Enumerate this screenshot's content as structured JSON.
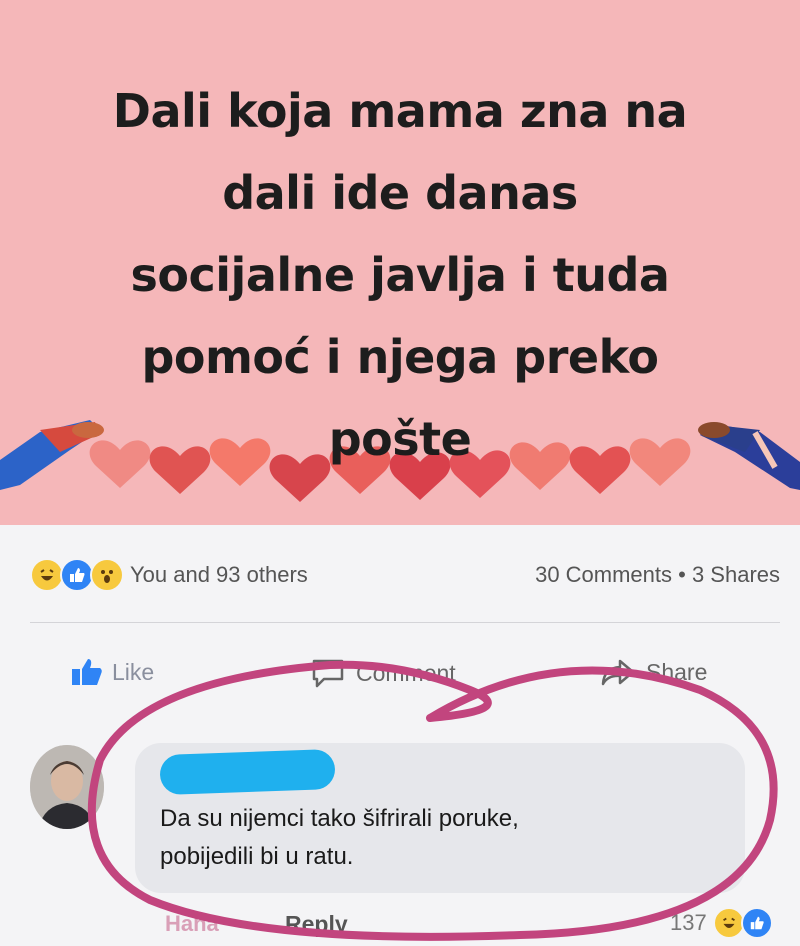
{
  "poster": {
    "title": "Dali koja mama zna na\ndali ide danas\nsocijalne javlja i tuda\npomoć i njega preko\npošte",
    "background": "#f5b7b9"
  },
  "post_stats": {
    "reactions_label": "You and 93 others",
    "comments_shares": "30 Comments • 3 Shares",
    "reaction_icons": [
      "haha-icon",
      "like-icon",
      "wow-icon"
    ]
  },
  "actions": {
    "like": "Like",
    "comment": "Comment",
    "share": "Share"
  },
  "comment": {
    "author": "",
    "text": "Da su nijemci tako šifrirali poruke,\npobijedili bi u ratu.",
    "time": "Haha",
    "reply": "Reply",
    "reaction_count": "137"
  },
  "colors": {
    "circle_annotation": "#c2457e",
    "redaction": "#1fb0ee",
    "like_blue": "#2f84f5"
  }
}
